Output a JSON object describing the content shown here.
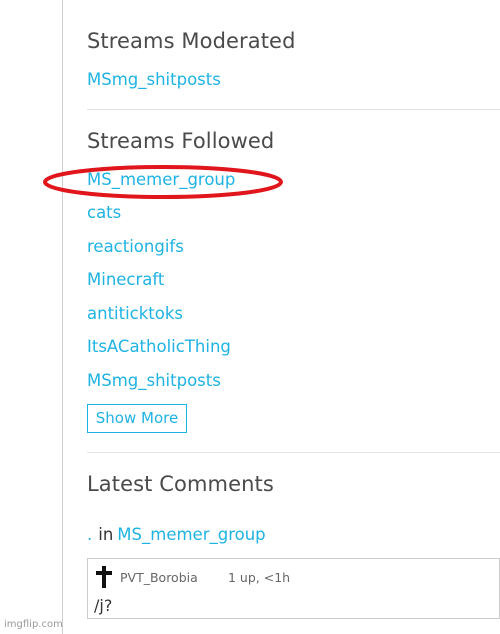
{
  "streams_moderated": {
    "title": "Streams Moderated",
    "items": [
      "MSmg_shitposts"
    ]
  },
  "streams_followed": {
    "title": "Streams Followed",
    "items": [
      "MS_memer_group",
      "cats",
      "reactiongifs",
      "Minecraft",
      "antiticktoks",
      "ItsACatholicThing",
      "MSmg_shitposts"
    ],
    "show_more_label": "Show More",
    "highlighted_item": "MS_memer_group",
    "highlight_color": "#e0161c"
  },
  "latest_comments": {
    "title": "Latest Comments",
    "items": [
      {
        "prefix": ".",
        "in_label": "in",
        "stream": "MS_memer_group",
        "author_icon": "cross-icon",
        "author": "PVT_Borobia",
        "meta": "1 up, <1h",
        "text": "/j?"
      }
    ]
  },
  "watermark": "imgflip.com",
  "colors": {
    "link": "#1fb3e3",
    "heading": "#4a4a4a",
    "annotation": "#e0161c"
  }
}
